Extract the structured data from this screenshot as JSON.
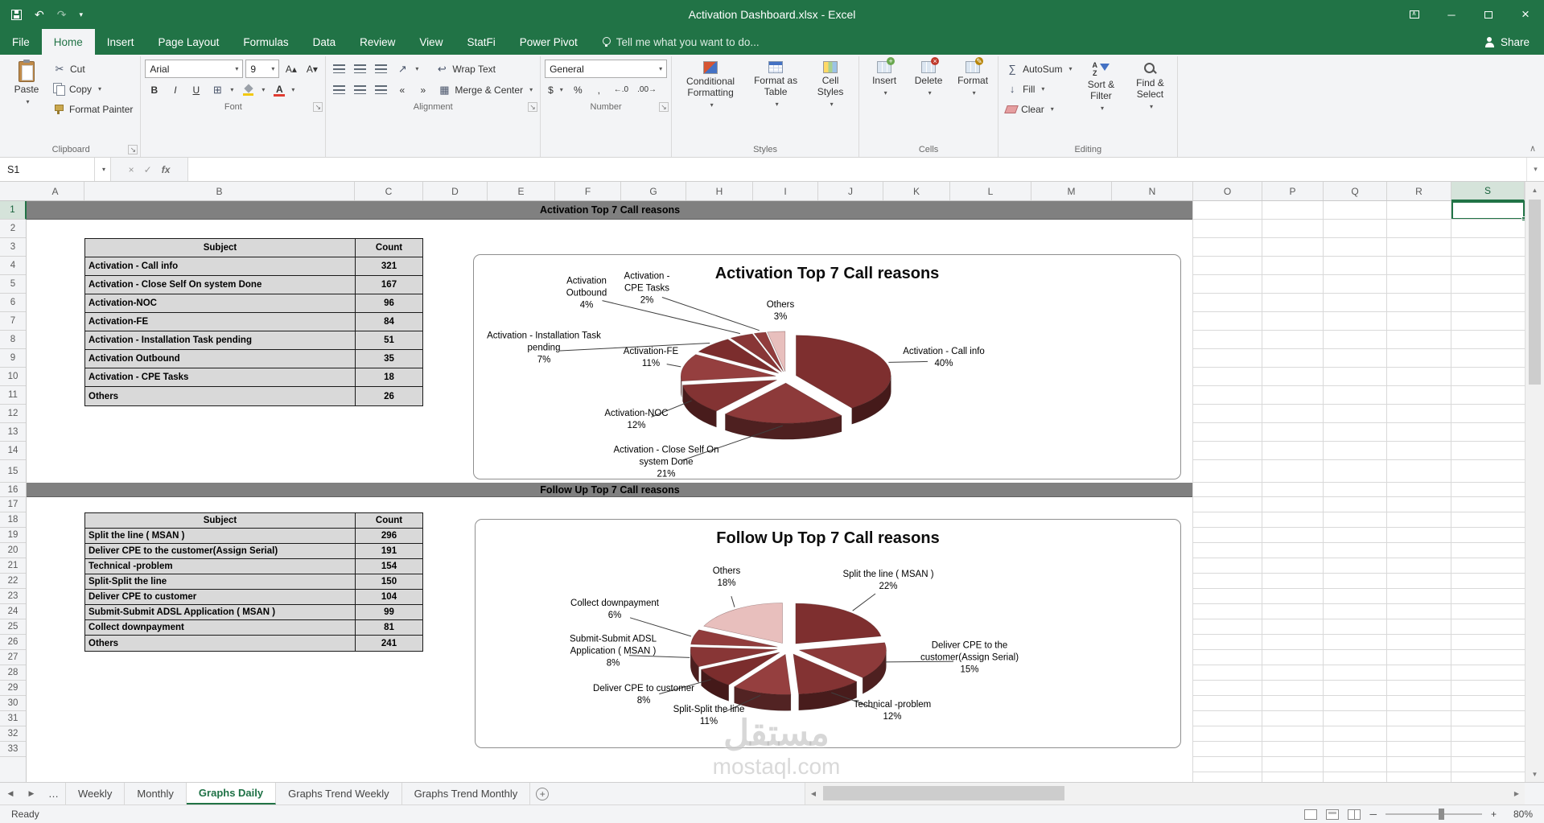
{
  "title_bar": {
    "title": "Activation Dashboard.xlsx - Excel"
  },
  "ribbon_tabs": {
    "items": [
      "File",
      "Home",
      "Insert",
      "Page Layout",
      "Formulas",
      "Data",
      "Review",
      "View",
      "StatFi",
      "Power Pivot"
    ],
    "active": "Home",
    "tell_me": "Tell me what you want to do...",
    "share": "Share"
  },
  "ribbon": {
    "clipboard": {
      "label": "Clipboard",
      "paste": "Paste",
      "cut": "Cut",
      "copy": "Copy",
      "format_painter": "Format Painter"
    },
    "font": {
      "label": "Font",
      "name": "Arial",
      "size": "9",
      "bold": "B",
      "italic": "I",
      "underline": "U"
    },
    "alignment": {
      "label": "Alignment",
      "wrap": "Wrap Text",
      "merge": "Merge & Center"
    },
    "number": {
      "label": "Number",
      "format": "General",
      "currency": "$",
      "percent": "%",
      "comma": ","
    },
    "styles": {
      "label": "Styles",
      "conditional": "Conditional Formatting",
      "format_table": "Format as Table",
      "cell_styles": "Cell Styles"
    },
    "cells": {
      "label": "Cells",
      "insert": "Insert",
      "delete": "Delete",
      "format": "Format"
    },
    "editing": {
      "label": "Editing",
      "autosum": "AutoSum",
      "fill": "Fill",
      "clear": "Clear",
      "sort": "Sort & Filter",
      "find": "Find & Select"
    }
  },
  "formula_bar": {
    "name_box": "S1",
    "fx": "fx",
    "formula": ""
  },
  "sheet": {
    "columns": [
      "A",
      "B",
      "C",
      "D",
      "E",
      "F",
      "G",
      "H",
      "I",
      "J",
      "K",
      "L",
      "M",
      "N",
      "O",
      "P",
      "Q",
      "R",
      "S"
    ],
    "selected_column": "S",
    "selected_row": 1,
    "num_rows": 33,
    "band1": "Activation Top 7 Call reasons",
    "band2": "Follow Up Top 7 Call reasons"
  },
  "table1": {
    "headers": [
      "Subject",
      "Count"
    ],
    "rows": [
      [
        "Activation - Call info",
        321
      ],
      [
        "Activation - Close Self On system Done",
        167
      ],
      [
        "Activation-NOC",
        96
      ],
      [
        "Activation-FE",
        84
      ],
      [
        "Activation - Installation Task pending",
        51
      ],
      [
        "Activation Outbound",
        35
      ],
      [
        "Activation - CPE Tasks",
        18
      ],
      [
        "Others",
        26
      ]
    ]
  },
  "table2": {
    "headers": [
      "Subject",
      "Count"
    ],
    "rows": [
      [
        "Split the line ( MSAN )",
        296
      ],
      [
        "Deliver CPE to the customer(Assign Serial)",
        191
      ],
      [
        "Technical -problem",
        154
      ],
      [
        "Split-Split the line",
        150
      ],
      [
        "Deliver CPE to customer",
        104
      ],
      [
        "Submit-Submit ADSL Application ( MSAN )",
        99
      ],
      [
        "Collect downpayment",
        81
      ],
      [
        "Others",
        241
      ]
    ]
  },
  "chart_data": [
    {
      "type": "pie",
      "title": "Activation Top 7 Call reasons",
      "legend_position": "none",
      "labels": [
        "Activation - Call info",
        "Activation - Close Self On system Done",
        "Activation-NOC",
        "Activation-FE",
        "Activation - Installation Task pending",
        "Activation Outbound",
        "Activation - CPE Tasks",
        "Others"
      ],
      "values": [
        321,
        167,
        96,
        84,
        51,
        35,
        18,
        26
      ],
      "percents": [
        40,
        21,
        12,
        11,
        7,
        4,
        2,
        3
      ],
      "colors": [
        "#7e2f2f",
        "#8d3a3a",
        "#833333",
        "#953f3f",
        "#7b2d2d",
        "#883636",
        "#913c3c",
        "#e8bfbd"
      ]
    },
    {
      "type": "pie",
      "title": "Follow Up Top 7 Call reasons",
      "legend_position": "none",
      "labels": [
        "Split the line ( MSAN )",
        "Deliver CPE to the customer(Assign Serial)",
        "Technical -problem",
        "Split-Split the line",
        "Deliver CPE to customer",
        "Submit-Submit ADSL Application ( MSAN )",
        "Collect downpayment",
        "Others"
      ],
      "values": [
        296,
        191,
        154,
        150,
        104,
        99,
        81,
        241
      ],
      "percents": [
        22,
        15,
        12,
        11,
        8,
        8,
        6,
        18
      ],
      "colors": [
        "#7e2f2f",
        "#8d3a3a",
        "#833333",
        "#953f3f",
        "#7b2d2d",
        "#883636",
        "#913c3c",
        "#e8bfbd"
      ]
    }
  ],
  "sheet_tabs": {
    "more": "…",
    "items": [
      "Weekly",
      "Monthly",
      "Graphs Daily",
      "Graphs Trend Weekly",
      "Graphs Trend Monthly"
    ],
    "active": "Graphs Daily"
  },
  "status_bar": {
    "mode": "Ready",
    "zoom": "80%"
  },
  "watermark": {
    "arabic": "مستقل",
    "latin": "mostaql.com"
  },
  "icons": {
    "dropdown": "▾",
    "dialog_launcher": "↘",
    "cut": "✂",
    "borders": "⊞",
    "wrap": "↩",
    "merge": "▦",
    "orientation": "↗",
    "indent_left": "«",
    "indent_right": "»",
    "autosum": "∑",
    "fill_arrow": "↓",
    "undo": "↶",
    "redo": "↷",
    "check": "✓",
    "cross": "×",
    "collapse": "∧",
    "nav_left": "◀",
    "nav_right": "▶",
    "minimize": "─",
    "close": "×",
    "scroll_up": "▲",
    "scroll_down": "▼",
    "scroll_left": "◀",
    "scroll_right": "▶",
    "increase_decimal": "←.0",
    "decrease_decimal": ".00→",
    "font_increase": "A▴",
    "font_decrease": "A▾",
    "font_color_letter": "A",
    "sort_a": "A",
    "sort_z": "Z",
    "add_sheet": "+"
  }
}
